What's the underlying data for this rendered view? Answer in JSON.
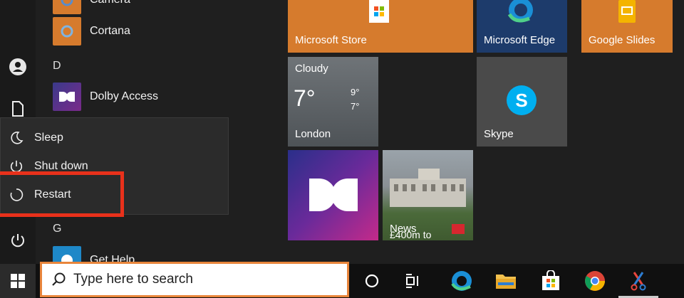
{
  "app_list": {
    "items": [
      {
        "label": "Camera"
      },
      {
        "label": "Cortana"
      },
      {
        "letter": "D"
      },
      {
        "label": "Dolby Access"
      },
      {
        "letter": "G"
      },
      {
        "label": "Get Help"
      }
    ]
  },
  "power_menu": {
    "sleep": "Sleep",
    "shutdown": "Shut down",
    "restart": "Restart"
  },
  "tiles": {
    "store": "Microsoft Store",
    "edge": "Microsoft Edge",
    "slides": "Google Slides",
    "weather": {
      "condition": "Cloudy",
      "temp": "7°",
      "high": "9°",
      "low": "7°",
      "city": "London"
    },
    "skype": "Skype",
    "news": {
      "label": "News",
      "sub": "£400m to"
    }
  },
  "taskbar": {
    "search_placeholder": "Type here to search"
  },
  "colors": {
    "accent_orange": "#d67b2d",
    "edge_blue": "#1d3b6b",
    "highlight_red": "#e8311b"
  }
}
